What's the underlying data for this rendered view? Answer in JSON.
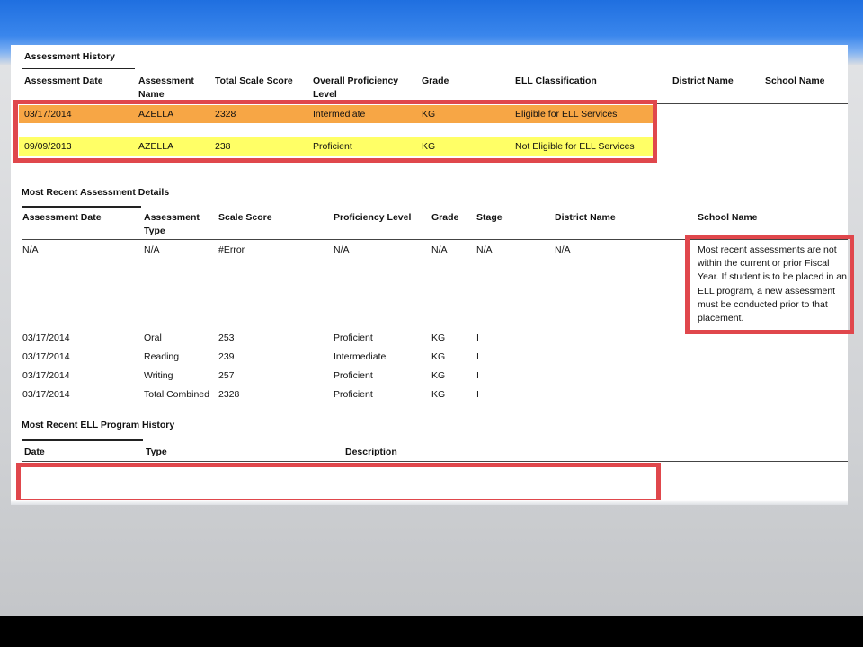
{
  "colors": {
    "highlight_orange": "#f7a645",
    "highlight_yellow": "#ffff66",
    "annotation_red": "#e0474c",
    "banner_blue": "#2a78e6"
  },
  "history": {
    "title": "Assessment History",
    "headers": {
      "date": "Assessment Date",
      "name": "Assessment Name",
      "score": "Total Scale Score",
      "level": "Overall Proficiency Level",
      "grade": "Grade",
      "ell": "ELL Classification",
      "district": "District Name",
      "school": "School Name"
    },
    "rows": [
      {
        "date": "03/17/2014",
        "name": "AZELLA",
        "score": "2328",
        "level": "Intermediate",
        "grade": "KG",
        "ell": "Eligible for ELL Services"
      },
      {
        "date": "09/09/2013",
        "name": "AZELLA",
        "score": "238",
        "level": "Proficient",
        "grade": "KG",
        "ell": "Not Eligible for ELL Services"
      }
    ]
  },
  "details": {
    "title": "Most Recent Assessment Details",
    "headers": {
      "date": "Assessment Date",
      "type": "Assessment Type",
      "score": "Scale Score",
      "level": "Proficiency Level",
      "grade": "Grade",
      "stage": "Stage",
      "district": "District Name",
      "school": "School Name"
    },
    "rows": [
      {
        "date": "N/A",
        "type": "N/A",
        "score": "#Error",
        "level": "N/A",
        "grade": "N/A",
        "stage": "N/A",
        "district": "N/A"
      },
      {
        "date": "03/17/2014",
        "type": "Oral",
        "score": "253",
        "level": "Proficient",
        "grade": "KG",
        "stage": "I"
      },
      {
        "date": "03/17/2014",
        "type": "Reading",
        "score": "239",
        "level": "Intermediate",
        "grade": "KG",
        "stage": "I"
      },
      {
        "date": "03/17/2014",
        "type": "Writing",
        "score": "257",
        "level": "Proficient",
        "grade": "KG",
        "stage": "I"
      },
      {
        "date": "03/17/2014",
        "type": "Total Combined",
        "score": "2328",
        "level": "Proficient",
        "grade": "KG",
        "stage": "I"
      }
    ],
    "note": "Most recent assessments are not within the current or prior Fiscal Year.  If student is to be placed in an ELL program, a new assessment must be conducted prior to that placement."
  },
  "program": {
    "title": "Most Recent ELL Program History",
    "headers": {
      "date": "Date",
      "type": "Type",
      "description": "Description"
    }
  }
}
